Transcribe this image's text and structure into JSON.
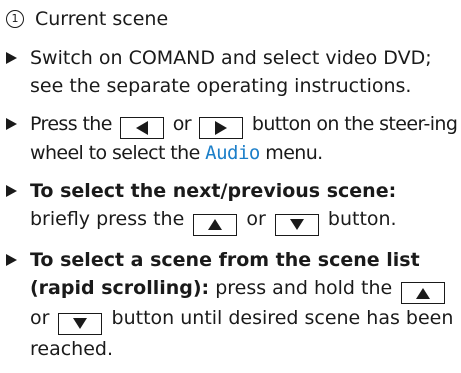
{
  "caption": {
    "number": "1",
    "text": "Current scene"
  },
  "steps": {
    "step1": {
      "text": "Switch on COMAND and select video DVD; see the separate operating instructions."
    },
    "step2": {
      "before": "Press the",
      "or": "or",
      "after_keys": "button on the steer-ing wheel to select the",
      "menu": "Audio",
      "end": "menu.",
      "menu_color": "#1c7fc9"
    },
    "step3": {
      "bold": "To select the next/previous scene:",
      "before": "briefly press the",
      "or": "or",
      "after": "button."
    },
    "step4": {
      "bold": "To select a scene from the scene list (rapid scrolling):",
      "before": "press and hold the",
      "or": "or",
      "after": "button until desired scene has been reached."
    }
  },
  "keys": {
    "left": "left-arrow-key-icon",
    "right": "right-arrow-key-icon",
    "up": "up-arrow-key-icon",
    "down": "down-arrow-key-icon"
  }
}
